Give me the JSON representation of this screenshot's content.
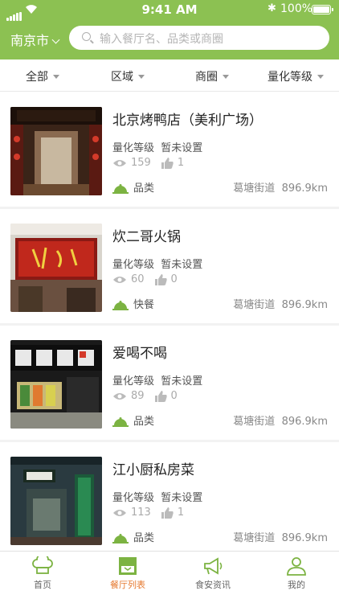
{
  "status_bar": {
    "time": "9:41 AM",
    "battery": "100%"
  },
  "header": {
    "city": "南京市",
    "search_placeholder": "输入餐厅名、品类或商圈"
  },
  "filters": [
    "全部",
    "区域",
    "商圈",
    "量化等级"
  ],
  "restaurants": [
    {
      "name": "北京烤鸭店（美利广场）",
      "grade_label": "量化等级",
      "grade_value": "暂未设置",
      "views": "159",
      "likes": "1",
      "category": "品类",
      "street": "葛塘街道",
      "distance": "896.9km"
    },
    {
      "name": "炊二哥火锅",
      "grade_label": "量化等级",
      "grade_value": "暂未设置",
      "views": "60",
      "likes": "0",
      "category": "快餐",
      "street": "葛塘街道",
      "distance": "896.9km"
    },
    {
      "name": "爱喝不喝",
      "grade_label": "量化等级",
      "grade_value": "暂未设置",
      "views": "89",
      "likes": "0",
      "category": "品类",
      "street": "葛塘街道",
      "distance": "896.9km"
    },
    {
      "name": "江小厨私房菜",
      "grade_label": "量化等级",
      "grade_value": "暂未设置",
      "views": "113",
      "likes": "1",
      "category": "品类",
      "street": "葛塘街道",
      "distance": "896.9km"
    }
  ],
  "tabs": [
    {
      "label": "首页",
      "icon": "chef-hat-icon"
    },
    {
      "label": "餐厅列表",
      "icon": "store-icon"
    },
    {
      "label": "食安资讯",
      "icon": "megaphone-icon"
    },
    {
      "label": "我的",
      "icon": "person-icon"
    }
  ],
  "colors": {
    "brand_green": "#8cc152",
    "active_tab": "#e67a31",
    "icon_green": "#7cb342"
  }
}
